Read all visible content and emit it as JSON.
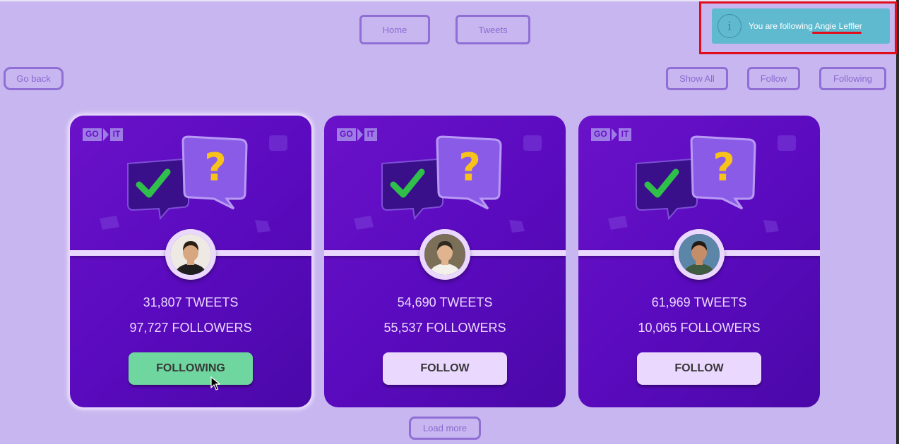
{
  "nav": {
    "home_label": "Home",
    "tweets_label": "Tweets"
  },
  "toolbar": {
    "go_back_label": "Go back",
    "show_all_label": "Show All",
    "follow_label": "Follow",
    "following_label": "Following"
  },
  "toast": {
    "message_prefix": "You are following ",
    "user_name": "Angie Leffler",
    "icon": "info-icon"
  },
  "cards": [
    {
      "logo_left": "GO",
      "logo_right": "IT",
      "tweets": "31,807 TWEETS",
      "followers": "97,727 FOLLOWERS",
      "button_label": "FOLLOWING",
      "is_following": true,
      "avatar": "avatar-man-dark-jacket"
    },
    {
      "logo_left": "GO",
      "logo_right": "IT",
      "tweets": "54,690 TWEETS",
      "followers": "55,537 FOLLOWERS",
      "button_label": "FOLLOW",
      "is_following": false,
      "avatar": "avatar-man-thumbs-up"
    },
    {
      "logo_left": "GO",
      "logo_right": "IT",
      "tweets": "61,969 TWEETS",
      "followers": "10,065 FOLLOWERS",
      "button_label": "FOLLOW",
      "is_following": false,
      "avatar": "avatar-man-green-shirt"
    }
  ],
  "load_more_label": "Load more",
  "colors": {
    "page_bg": "#c8b6f0",
    "card_bg": "#5b0bbf",
    "button_bg": "#ebd8ff",
    "following_bg": "#6fd69f",
    "toast_bg": "#5fb9cf",
    "highlight_red": "#e00d1b"
  }
}
